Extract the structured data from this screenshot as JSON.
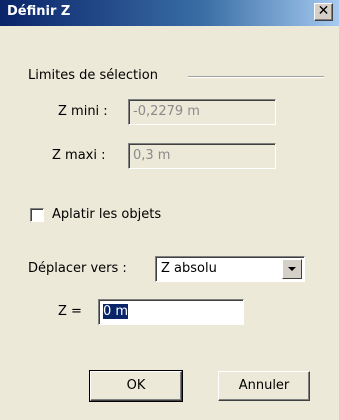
{
  "window": {
    "title": "Définir Z",
    "close_icon": "close-icon"
  },
  "selection_limits": {
    "label": "Limites de sélection",
    "z_min_label": "Z mini :",
    "z_min_value": "-0,2279 m",
    "z_max_label": "Z maxi :",
    "z_max_value": "0,3 m"
  },
  "flatten": {
    "label": "Aplatir les objets",
    "checked": false
  },
  "move_to": {
    "label": "Déplacer vers :",
    "selected": "Z absolu"
  },
  "z_input": {
    "label": "Z =",
    "value": "0 m"
  },
  "buttons": {
    "ok": "OK",
    "cancel": "Annuler"
  }
}
